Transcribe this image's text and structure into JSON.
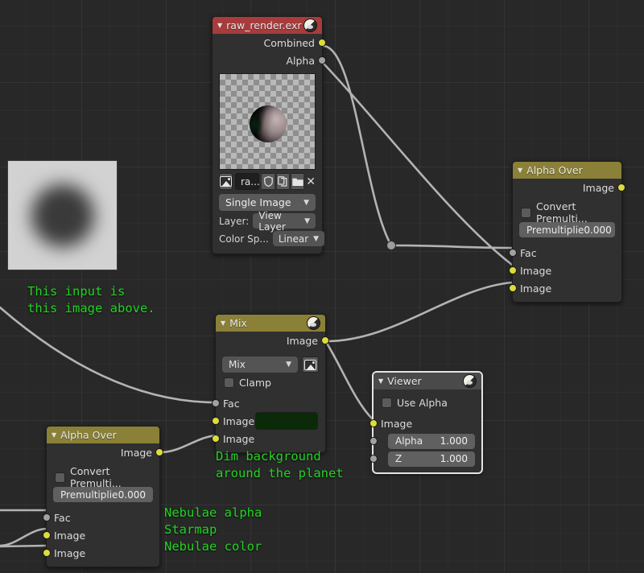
{
  "editor": {
    "name": "blender-compositor-node-editor",
    "background": "#282828",
    "grid": true
  },
  "nodes": {
    "image_node": {
      "title": "raw_render.exr",
      "header_color": "#a83c3c",
      "collapse_glyph": "▼",
      "header_icon": "image-sphere-icon",
      "outputs": [
        {
          "label": "Combined",
          "socket": "yellow"
        },
        {
          "label": "Alpha",
          "socket": "gray"
        }
      ],
      "preview": "planet-on-checkerboard",
      "file_row": {
        "browse_icon": "image-browse-icon",
        "name_value": "ra...",
        "shield_icon": "fake-user-shield-icon",
        "copy_icon": "new-datablock-copy-icon",
        "open_icon": "open-folder-icon",
        "close_icon": "unlink-x-icon"
      },
      "source_dropdown": "Single Image",
      "layer_label": "Layer:",
      "layer_value": "View Layer",
      "colorspace_label": "Color Sp...",
      "colorspace_value": "Linear"
    },
    "alpha_over_right": {
      "title": "Alpha Over",
      "header_color": "#8a8037",
      "collapse_glyph": "▼",
      "outputs": [
        {
          "label": "Image",
          "socket": "yellow"
        }
      ],
      "convert_premul_label": "Convert Premulti...",
      "convert_premul_checked": false,
      "premul_label": "Premultiplie",
      "premul_value": "0.000",
      "inputs": [
        {
          "label": "Fac",
          "socket": "gray"
        },
        {
          "label": "Image",
          "socket": "yellow"
        },
        {
          "label": "Image",
          "socket": "yellow"
        }
      ]
    },
    "mix_node": {
      "title": "Mix",
      "header_color": "#8a8037",
      "collapse_glyph": "▼",
      "header_icon": "image-sphere-icon",
      "outputs": [
        {
          "label": "Image",
          "socket": "yellow"
        }
      ],
      "blend_mode": "Mix",
      "blend_icon": "image-thumb-icon",
      "clamp_label": "Clamp",
      "clamp_checked": false,
      "inputs": [
        {
          "label": "Fac",
          "socket": "gray"
        },
        {
          "label": "Image",
          "socket": "yellow",
          "color_value": "#0a2a08"
        },
        {
          "label": "Image",
          "socket": "yellow"
        }
      ]
    },
    "viewer_node": {
      "title": "Viewer",
      "header_color": "#4a4a4a",
      "collapse_glyph": "▼",
      "header_icon": "image-sphere-icon",
      "selected": true,
      "use_alpha_label": "Use Alpha",
      "use_alpha_checked": false,
      "inputs": [
        {
          "label": "Image",
          "socket": "yellow"
        },
        {
          "label": "Alpha",
          "socket": "gray",
          "value": "1.000"
        },
        {
          "label": "Z",
          "socket": "gray",
          "value": "1.000"
        }
      ]
    },
    "alpha_over_left": {
      "title": "Alpha Over",
      "header_color": "#8a8037",
      "collapse_glyph": "▼",
      "outputs": [
        {
          "label": "Image",
          "socket": "yellow"
        }
      ],
      "convert_premul_label": "Convert Premulti...",
      "convert_premul_checked": false,
      "premul_label": "Premultiplie",
      "premul_value": "0.000",
      "inputs": [
        {
          "label": "Fac",
          "socket": "gray"
        },
        {
          "label": "Image",
          "socket": "yellow"
        },
        {
          "label": "Image",
          "socket": "yellow"
        }
      ]
    }
  },
  "annotations": {
    "input_note": "This input is\nthis image above.",
    "dim_note": "Dim background\naround the planet",
    "legend": "Nebulae alpha\nStarmap\nNebulae color"
  },
  "colors": {
    "accent_yellow_socket": "#dcdc3c",
    "gray_socket": "#a1a1a1",
    "annotation_green": "#22d322",
    "link": "#b3b3b3",
    "node_body": "#303030"
  }
}
